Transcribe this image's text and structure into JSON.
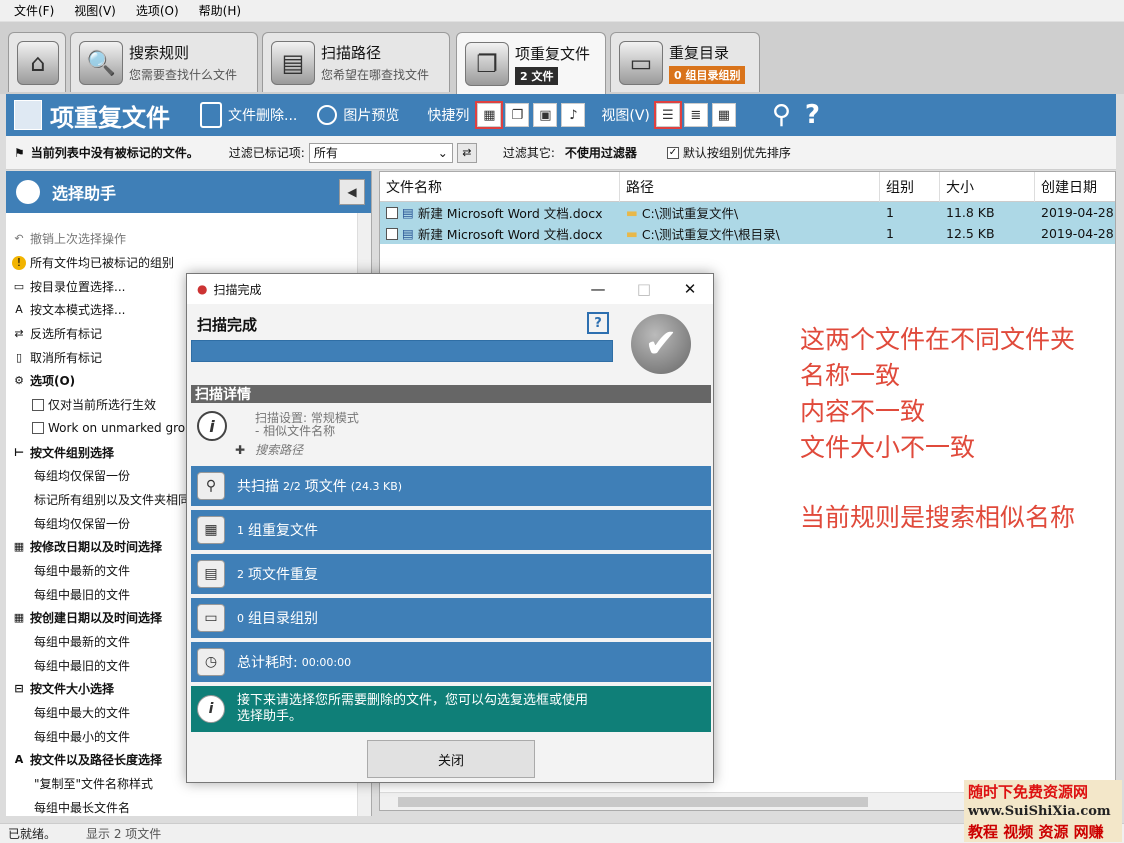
{
  "menu": [
    "文件(F)",
    "视图(V)",
    "选项(O)",
    "帮助(H)"
  ],
  "tabs": [
    {
      "title": "搜索规则",
      "sub": "您需要查找什么文件"
    },
    {
      "title": "扫描路径",
      "sub": "您希望在哪查找文件"
    },
    {
      "title": "项重复文件",
      "badge": "2 文件"
    },
    {
      "title": "重复目录",
      "badge": "0 组目录组别"
    }
  ],
  "toolbar": {
    "title": "项重复文件",
    "delete": "文件删除...",
    "preview": "图片预览",
    "quick_columns": "快捷列",
    "view": "视图(V)"
  },
  "filter": {
    "status": "当前列表中没有被标记的文件。",
    "filter_label": "过滤已标记项:",
    "filter_value": "所有",
    "other_label": "过滤其它:",
    "other_value": "不使用过滤器",
    "sort_label": "默认按组别优先排序"
  },
  "sidebar": {
    "title": "选择助手",
    "items": [
      {
        "label": "撤销上次选择操作",
        "icon": "undo-icon",
        "style": "muted"
      },
      {
        "label": "所有文件均已被标记的组别",
        "icon": "warning-icon"
      },
      {
        "label": "按目录位置选择...",
        "icon": "folder-icon"
      },
      {
        "label": "按文本模式选择...",
        "icon": "text-icon"
      },
      {
        "label": "反选所有标记",
        "icon": "invert-icon"
      },
      {
        "label": "取消所有标记",
        "icon": "clear-icon"
      },
      {
        "label": "选项(O)",
        "icon": "gear-icon",
        "style": "bold"
      },
      {
        "label": "仅对当前所选行生效",
        "icon": "checkbox-icon",
        "style": "indent"
      },
      {
        "label": "Work on unmarked gro",
        "icon": "checkbox-icon",
        "style": "indent"
      },
      {
        "label": "按文件组别选择",
        "icon": "tree-icon",
        "style": "bold"
      },
      {
        "label": "每组均仅保留一份",
        "style": "indent"
      },
      {
        "label": "标记所有组别以及文件夹相同",
        "style": "indent"
      },
      {
        "label": "每组均仅保留一份",
        "style": "indent"
      },
      {
        "label": "按修改日期以及时间选择",
        "icon": "calendar-icon",
        "style": "bold"
      },
      {
        "label": "每组中最新的文件",
        "style": "indent"
      },
      {
        "label": "每组中最旧的文件",
        "style": "indent"
      },
      {
        "label": "按创建日期以及时间选择",
        "icon": "calendar-icon",
        "style": "bold"
      },
      {
        "label": "每组中最新的文件",
        "style": "indent"
      },
      {
        "label": "每组中最旧的文件",
        "style": "indent"
      },
      {
        "label": "按文件大小选择",
        "icon": "size-icon",
        "style": "bold"
      },
      {
        "label": "每组中最大的文件",
        "style": "indent"
      },
      {
        "label": "每组中最小的文件",
        "style": "indent"
      },
      {
        "label": "按文件以及路径长度选择",
        "icon": "text-icon",
        "style": "bold"
      },
      {
        "label": "\"复制至\"文件名称样式",
        "style": "indent"
      },
      {
        "label": "每组中最长文件名",
        "style": "indent"
      }
    ]
  },
  "filelist": {
    "headers": [
      "文件名称",
      "路径",
      "组别",
      "大小",
      "创建日期"
    ],
    "rows": [
      {
        "name": "新建 Microsoft Word 文档.docx",
        "path": "C:\\测试重复文件\\",
        "group": "1",
        "size": "11.8 KB",
        "date": "2019-04-28"
      },
      {
        "name": "新建 Microsoft Word 文档.docx",
        "path": "C:\\测试重复文件\\根目录\\",
        "group": "1",
        "size": "12.5 KB",
        "date": "2019-04-28"
      }
    ]
  },
  "annotation": {
    "lines": [
      "这两个文件在不同文件夹",
      "名称一致",
      "内容不一致",
      "文件大小不一致"
    ],
    "rule": "当前规则是搜索相似名称"
  },
  "dialog": {
    "title": "扫描完成",
    "heading": "扫描完成",
    "details_title": "扫描详情",
    "scan_setting": "扫描设置: 常规模式",
    "similar": "- 相似文件名称",
    "search_path": "搜索路径",
    "scanned_prefix": "共扫描",
    "scanned_count": "2/2",
    "scanned_suffix": "项文件",
    "scanned_size": "(24.3 KB)",
    "groups_count": "1",
    "groups_label": "组重复文件",
    "dup_count": "2",
    "dup_label": "项文件重复",
    "dir_count": "0",
    "dir_label": "组目录组别",
    "time_label": "总计耗时:",
    "time_value": "00:00:00",
    "next_line1": "接下来请选择您所需要删除的文件，您可以勾选复选框或使用",
    "next_line2": "选择助手。",
    "close": "关闭"
  },
  "status": {
    "left": "已就绪。",
    "right": "显示 2 项文件"
  },
  "watermark": {
    "line1": "随时下免费资源网",
    "line2": "www.SuiShiXia.com",
    "line3": "教程 视频 资源 网赚"
  }
}
